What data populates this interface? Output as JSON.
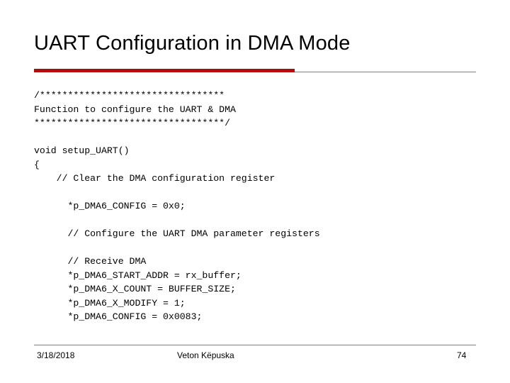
{
  "slide": {
    "title": "UART Configuration in DMA Mode",
    "accent_color": "#cc0000",
    "rule_color": "#808080",
    "code": "/*********************************\nFunction to configure the UART & DMA\n**********************************/\n\nvoid setup_UART()\n{\n    // Clear the DMA configuration register\n\n      *p_DMA6_CONFIG = 0x0;\n\n      // Configure the UART DMA parameter registers\n\n      // Receive DMA\n      *p_DMA6_START_ADDR = rx_buffer;\n      *p_DMA6_X_COUNT = BUFFER_SIZE;\n      *p_DMA6_X_MODIFY = 1;\n      *p_DMA6_CONFIG = 0x0083;",
    "footer": {
      "date": "3/18/2018",
      "author": "Veton Këpuska",
      "page_number": "74"
    }
  }
}
